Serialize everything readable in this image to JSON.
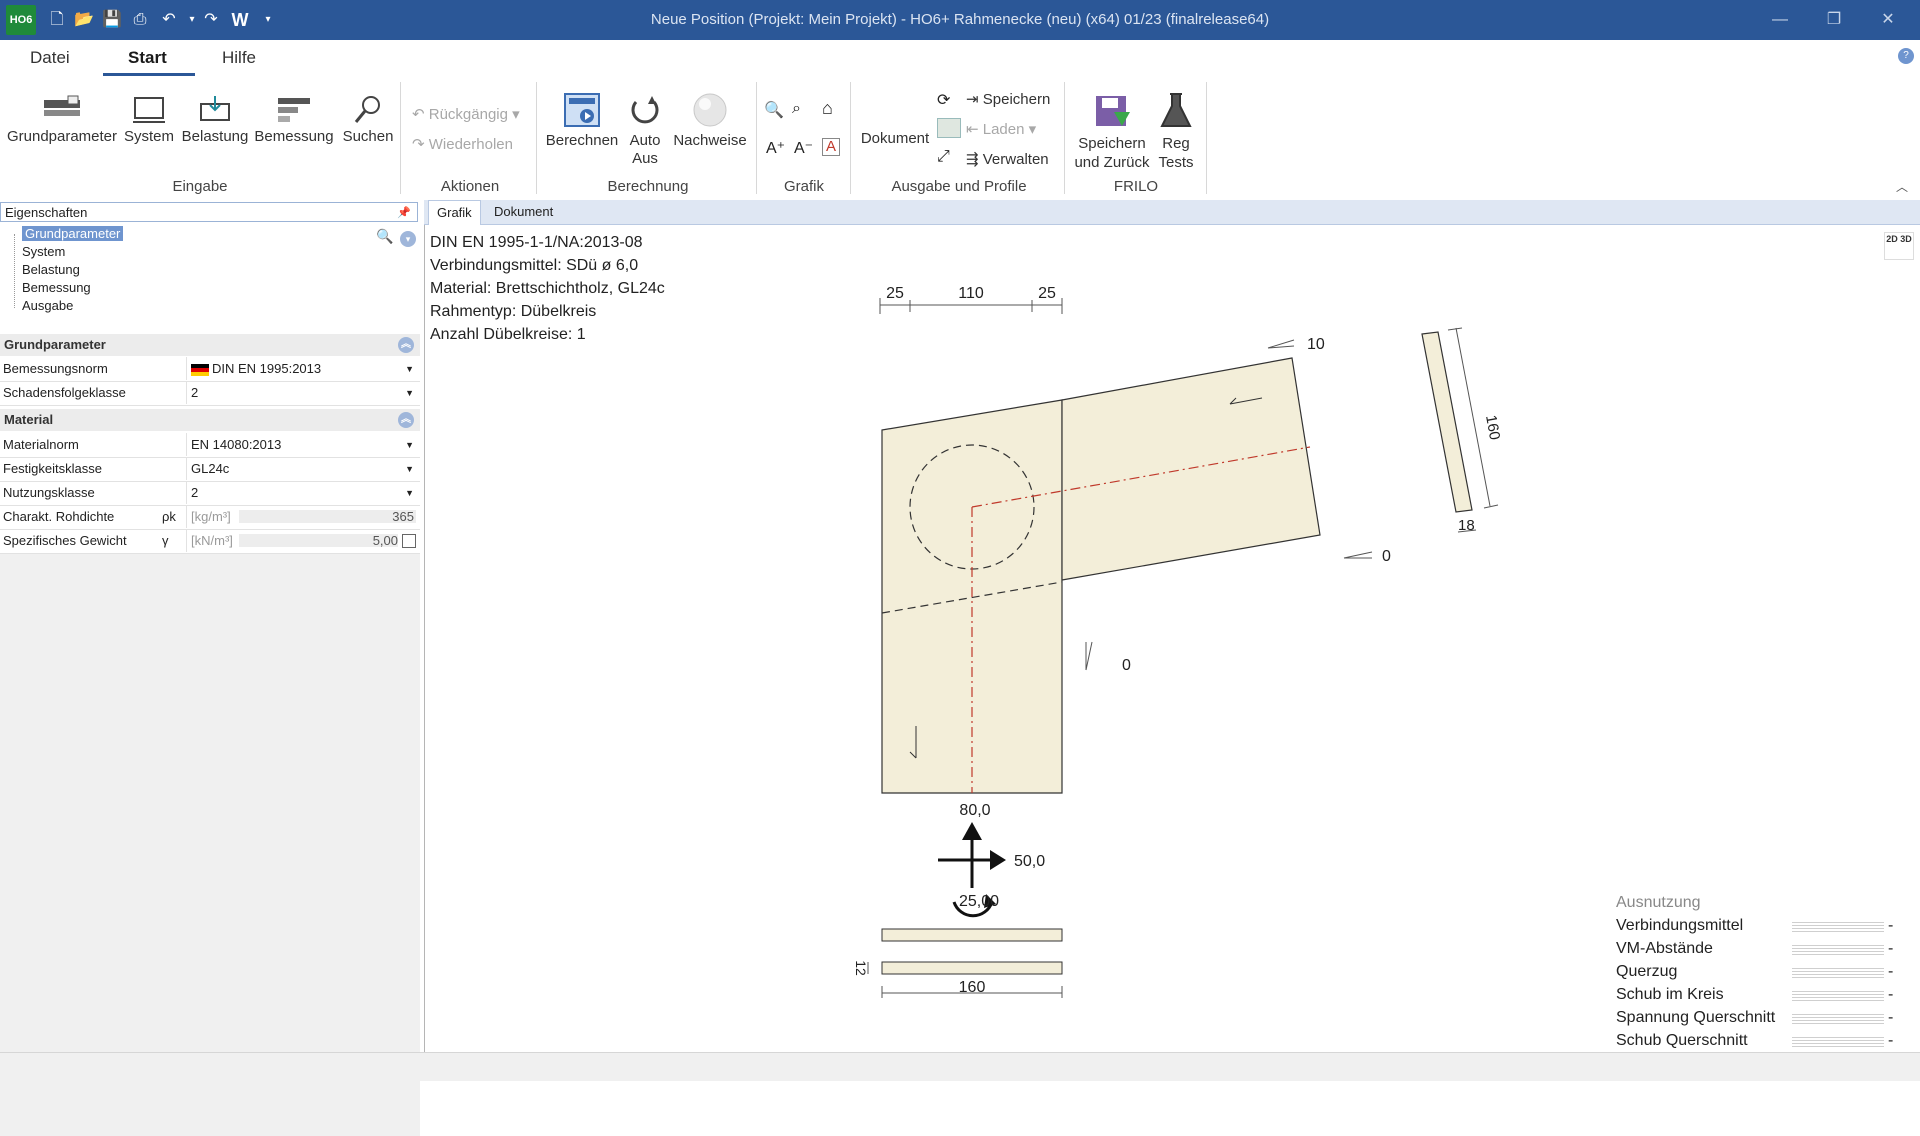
{
  "titlebar": {
    "app_logo": "HO6",
    "title": "Neue Position (Projekt: Mein Projekt) - HO6+ Rahmenecke (neu) (x64) 01/23 (finalrelease64)",
    "quick_w": "W"
  },
  "menu": {
    "tabs": [
      "Datei",
      "Start",
      "Hilfe"
    ]
  },
  "ribbon": {
    "eingabe": {
      "label": "Eingabe",
      "buttons": [
        "Grundparameter",
        "System",
        "Belastung",
        "Bemessung",
        "Suchen"
      ]
    },
    "aktionen": {
      "label": "Aktionen",
      "undo": "Rückgängig",
      "redo": "Wiederholen"
    },
    "berechnung": {
      "label": "Berechnung",
      "berechnen": "Berechnen",
      "auto_line1": "Auto",
      "auto_line2": "Aus",
      "nachweise": "Nachweise"
    },
    "grafik": {
      "label": "Grafik"
    },
    "ausgabe": {
      "label": "Ausgabe und Profile",
      "dokument": "Dokument",
      "speichern": "Speichern",
      "laden": "Laden",
      "verwalten": "Verwalten"
    },
    "frilo": {
      "label": "FRILO",
      "speichern_line1": "Speichern",
      "speichern_line2": "und Zurück",
      "reg_line1": "Reg",
      "reg_line2": "Tests"
    }
  },
  "left_panel": {
    "title": "Eigenschaften",
    "tree": [
      "Grundparameter",
      "System",
      "Belastung",
      "Bemessung",
      "Ausgabe"
    ],
    "grundparameter": {
      "header": "Grundparameter",
      "rows": [
        {
          "key": "Bemessungsnorm",
          "value": "DIN EN 1995:2013"
        },
        {
          "key": "Schadensfolgeklasse",
          "value": "2"
        }
      ]
    },
    "material": {
      "header": "Material",
      "rows": [
        {
          "key": "Materialnorm",
          "value": "EN 14080:2013"
        },
        {
          "key": "Festigkeitsklasse",
          "value": "GL24c"
        },
        {
          "key": "Nutzungsklasse",
          "value": "2"
        }
      ],
      "rohdichte": {
        "key": "Charakt. Rohdichte",
        "sym": "ρk",
        "unit": "[kg/m³]",
        "value": "365"
      },
      "gewicht": {
        "key": "Spezifisches Gewicht",
        "sym": "γ",
        "unit": "[kN/m³]",
        "value": "5,00"
      }
    }
  },
  "content": {
    "tabs": [
      "Grafik",
      "Dokument"
    ],
    "info": [
      "DIN EN 1995-1-1/NA:2013-08",
      "Verbindungsmittel: SDü ø 6,0",
      "Material: Brettschichtholz, GL24c",
      "Rahmentyp:  Dübelkreis",
      "Anzahl Dübelkreise: 1"
    ],
    "drawing": {
      "dim_top": [
        "25",
        "110",
        "25"
      ],
      "angle_top": "10",
      "angle_right": "0",
      "angle_col": "0",
      "section_height": "160",
      "section_width": "18",
      "load_v": "80,0",
      "load_h": "50,0",
      "load_m": "25,00",
      "bottom_width": "160",
      "bottom_thick": "12"
    },
    "ausnutzung": {
      "title": "Ausnutzung",
      "rows": [
        {
          "label": "Verbindungsmittel",
          "value": "-"
        },
        {
          "label": "VM-Abstände",
          "value": "-"
        },
        {
          "label": "Querzug",
          "value": "-"
        },
        {
          "label": "Schub im Kreis",
          "value": "-"
        },
        {
          "label": "Spannung Querschnitt",
          "value": "-"
        },
        {
          "label": "Schub Querschnitt",
          "value": "-"
        }
      ]
    },
    "view_toggle": "2D 3D"
  },
  "colors": {
    "titlebar": "#2b5797",
    "wood": "#f3eed9",
    "axis": "#c0392b"
  }
}
